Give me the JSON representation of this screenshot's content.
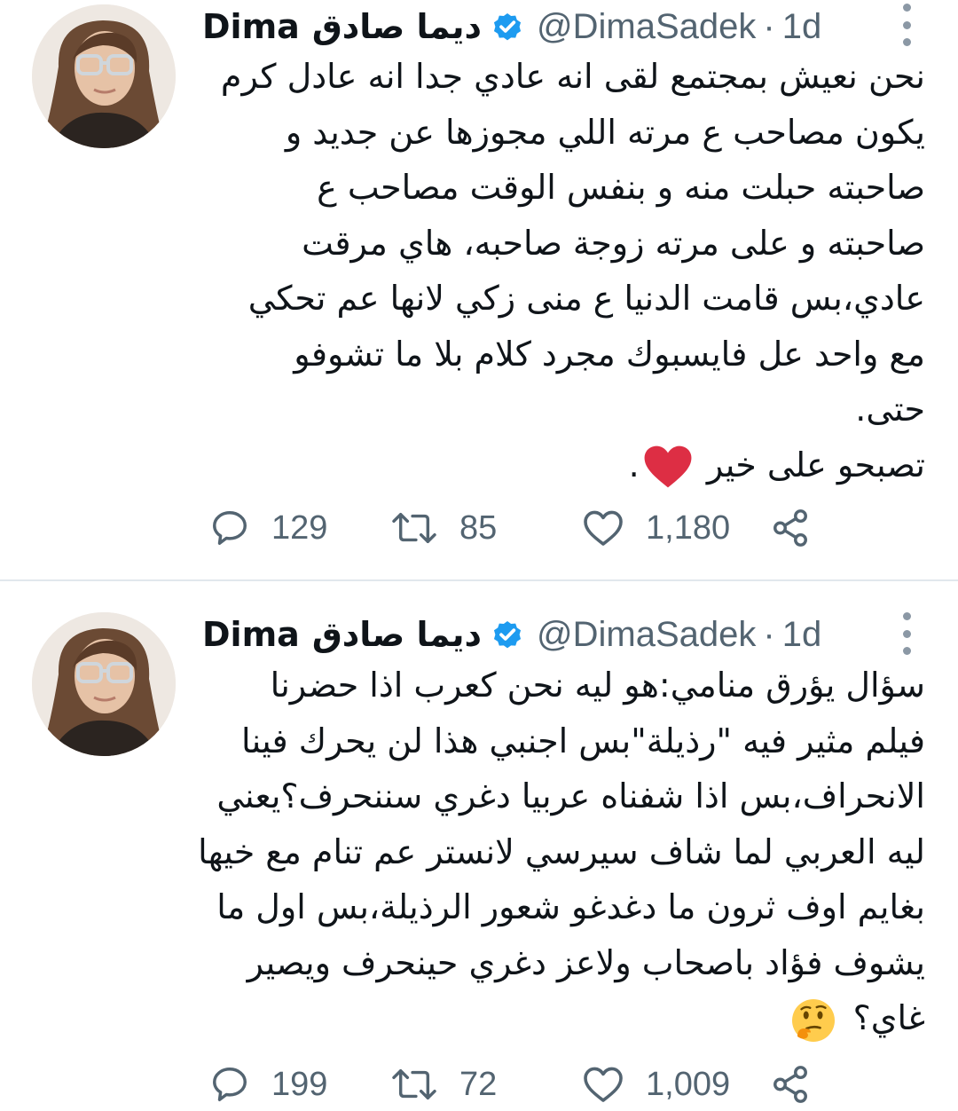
{
  "tweets": [
    {
      "name_latin": "Dima",
      "name_arabic": "ديما صادق",
      "handle": "@DimaSadek",
      "separator": "·",
      "time": "1d",
      "lines": [
        "نحن نعيش بمجتمع لقى انه عادي جدا انه عادل كرم",
        "يكون مصاحب ع مرته اللي مجوزها عن جديد و",
        "صاحبته حبلت منه و بنفس الوقت مصاحب ع",
        "صاحبته و على مرته زوجة صاحبه، هاي مرقت",
        "عادي،بس قامت الدنيا ع منى زكي  لانها عم تحكي",
        "مع واحد عل فايسبوك مجرد كلام بلا ما تشوفو",
        "حتى.",
        "تصبحو على خير"
      ],
      "final_line_suffix": ".",
      "final_emoji": "red-heart-emoji",
      "replies": "129",
      "retweets": "85",
      "likes": "1,180"
    },
    {
      "name_latin": "Dima",
      "name_arabic": "ديما صادق",
      "handle": "@DimaSadek",
      "separator": "·",
      "time": "1d",
      "lines": [
        "سؤال يؤرق منامي:هو ليه نحن كعرب اذا حضرنا",
        "فيلم مثير  فيه \"رذيلة\"بس اجنبي هذا لن يحرك فينا",
        "الانحراف،بس اذا شفناه عربيا دغري سننحرف؟يعني",
        "ليه العربي لما شاف سيرسي لانستر عم تنام مع خيها",
        "بغايم اوف ثرون ما دغدغو شعور الرذيلة،بس اول ما",
        "يشوف فؤاد باصحاب ولاعز دغري حينحرف ويصير",
        "غاي؟"
      ],
      "final_emoji": "thinking-face-emoji",
      "replies": "199",
      "retweets": "72",
      "likes": "1,009"
    }
  ],
  "icons": {
    "reply": "reply-icon",
    "retweet": "retweet-icon",
    "like": "heart-icon",
    "share": "share-icon",
    "verified": "verified-badge-icon",
    "more": "more-options-icon"
  },
  "colors": {
    "text": "#0f1419",
    "secondary": "#536471",
    "verified": "#1d9bf0",
    "divider": "#e1e8ed",
    "heart_emoji": "#dd2e44"
  }
}
